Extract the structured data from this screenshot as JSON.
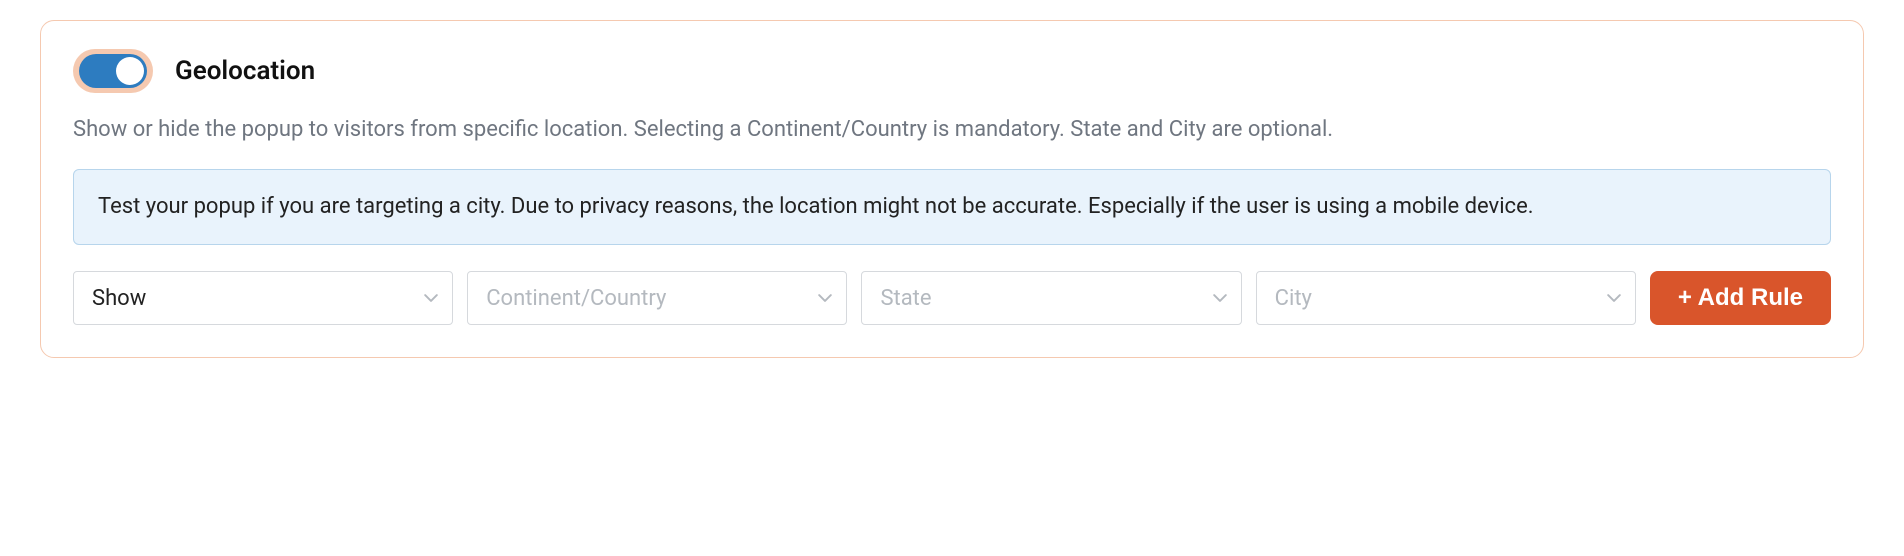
{
  "panel": {
    "title": "Geolocation",
    "toggle_on": true,
    "description": "Show or hide the popup to visitors from specific location. Selecting a Continent/Country is mandatory. State and City are optional.",
    "info": "Test your popup if you are targeting a city. Due to privacy reasons, the location might not be accurate. Especially if the user is using a mobile device."
  },
  "controls": {
    "action": {
      "value": "Show"
    },
    "continent_country": {
      "placeholder": "Continent/Country"
    },
    "state": {
      "placeholder": "State"
    },
    "city": {
      "placeholder": "City"
    },
    "add_rule_label": "+ Add Rule"
  }
}
